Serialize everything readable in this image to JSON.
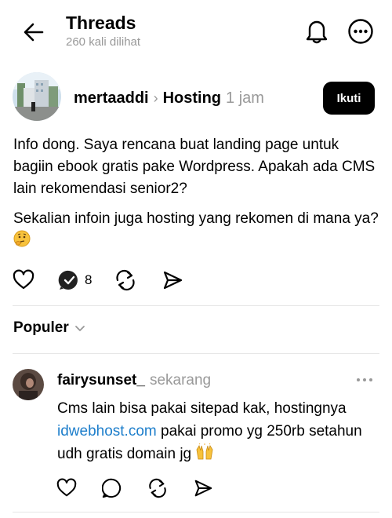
{
  "header": {
    "title": "Threads",
    "subtitle": "260 kali dilihat",
    "icons": {
      "back": "arrow-left-icon",
      "notifications": "bell-icon",
      "more": "more-circle-icon"
    }
  },
  "post": {
    "username": "mertaaddi",
    "topic": "Hosting",
    "time": "1 jam",
    "follow_label": "Ikuti",
    "paragraphs": [
      "Info dong. Saya rencana buat landing page untuk bagiin ebook gratis pake Wordpress. Apakah ada CMS lain rekomendasi senior2?",
      "Sekalian infoin juga hosting yang rekomen di mana ya?"
    ],
    "emoji": "🤔",
    "reply_count": "8"
  },
  "sort": {
    "label": "Populer"
  },
  "reply": {
    "username": "fairysunset_",
    "time": "sekarang",
    "text_before": "Cms lain bisa pakai sitepad kak, hostingnya ",
    "link_text": "idwebhost.com",
    "text_after": " pakai promo yg 250rb setahun udh gratis domain jg ",
    "emoji": "🙌"
  },
  "colors": {
    "accent_link": "#1d7ecb",
    "muted": "#999999",
    "follow_bg": "#000000"
  }
}
